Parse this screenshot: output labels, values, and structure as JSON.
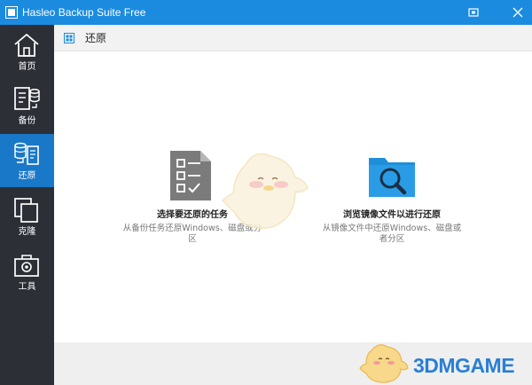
{
  "window": {
    "title": "Hasleo Backup Suite Free",
    "accent": "#1b8be0"
  },
  "sidebar": {
    "items": [
      {
        "label": "首页",
        "icon": "home-icon",
        "active": false
      },
      {
        "label": "备份",
        "icon": "backup-icon",
        "active": false
      },
      {
        "label": "还原",
        "icon": "restore-icon",
        "active": true
      },
      {
        "label": "克隆",
        "icon": "clone-icon",
        "active": false
      },
      {
        "label": "工具",
        "icon": "tools-icon",
        "active": false
      }
    ],
    "bg": "#2c2f36",
    "active_bg": "#1a78c8"
  },
  "header": {
    "title": "还原",
    "icon": "grid-icon"
  },
  "options": [
    {
      "title": "选择要还原的任务",
      "desc_line1": "从备份任务还原Windows、磁盘或分",
      "desc_line2": "区",
      "icon": "task-checklist-icon"
    },
    {
      "title": "浏览镜像文件以进行还原",
      "desc_line1": "从镜像文件中还原Windows、磁盘或",
      "desc_line2": "者分区",
      "icon": "folder-search-icon"
    }
  ],
  "watermark": {
    "text": "3DMGAME"
  }
}
